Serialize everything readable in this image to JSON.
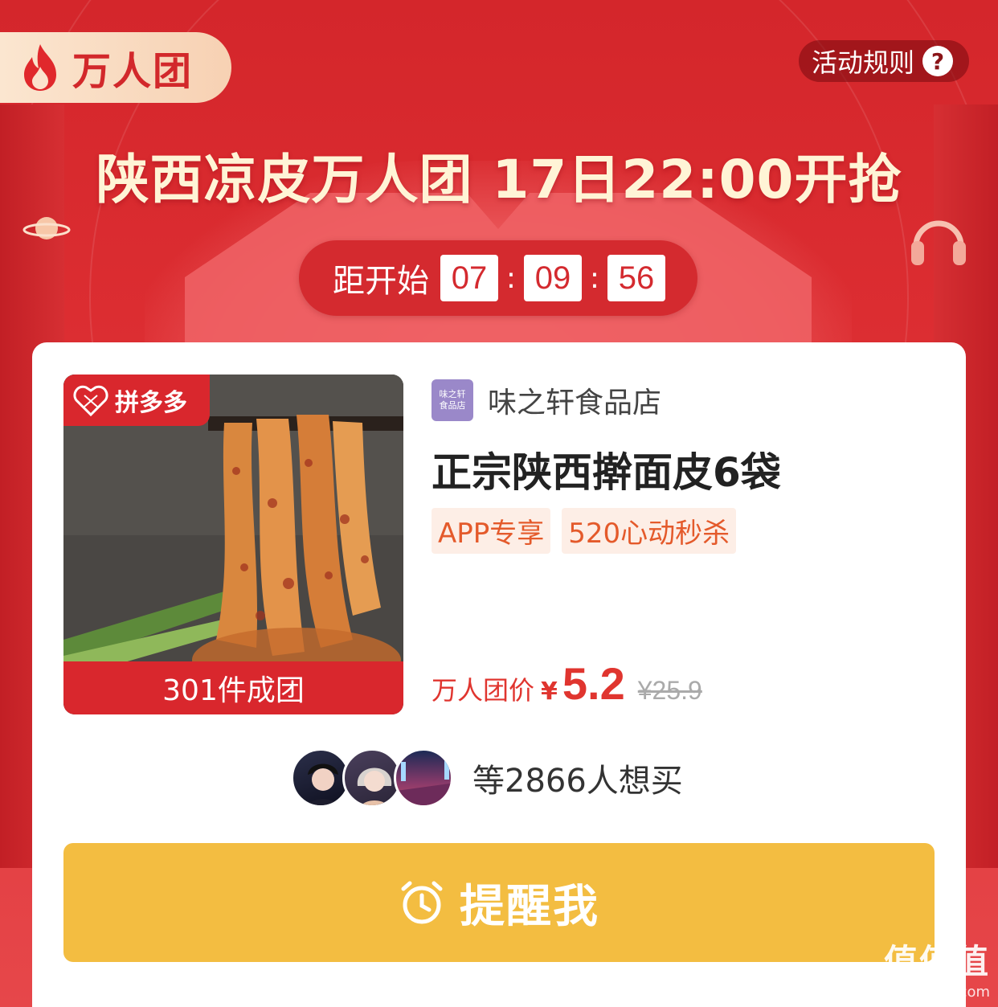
{
  "badge": {
    "label": "万人团",
    "icon": "flame-icon"
  },
  "rules": {
    "label": "活动规则",
    "help_glyph": "?"
  },
  "headline": "陕西凉皮万人团 17日22:00开抢",
  "countdown": {
    "label": "距开始",
    "hours": "07",
    "minutes": "09",
    "seconds": "56",
    "separator": ":"
  },
  "product": {
    "platform_tag": "拼多多",
    "group_label": "301件成团",
    "shop_logo_text": "味之轩\n食品店",
    "shop_name": "味之轩食品店",
    "title": "正宗陕西擀面皮6袋",
    "tags": [
      "APP专享",
      "520心动秒杀"
    ],
    "price_label": "万人团价",
    "currency": "¥",
    "price": "5.2",
    "original_price": "¥25.9"
  },
  "want": {
    "text": "等2866人想买",
    "avatar_count": 3
  },
  "remind_button": {
    "label": "提醒我",
    "icon": "alarm-clock-icon"
  },
  "watermark": {
    "brand": "值值值",
    "url": "zhizhizhi.com"
  },
  "colors": {
    "brand_red": "#d9272d",
    "button_yellow": "#f3bd41",
    "price_red": "#e0352f",
    "tag_orange": "#e45a2b"
  }
}
